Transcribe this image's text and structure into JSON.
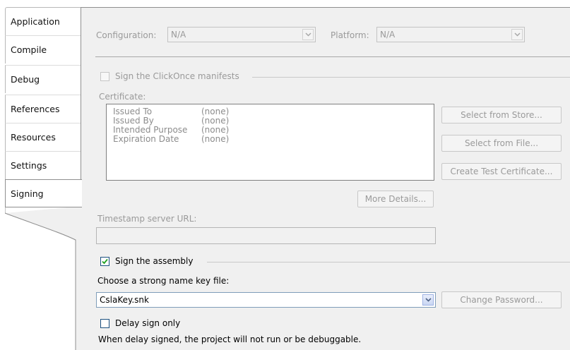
{
  "tabs": [
    {
      "label": "Application"
    },
    {
      "label": "Compile"
    },
    {
      "label": "Debug"
    },
    {
      "label": "References"
    },
    {
      "label": "Resources"
    },
    {
      "label": "Settings"
    },
    {
      "label": "Signing",
      "active": true
    }
  ],
  "config": {
    "configuration_label": "Configuration:",
    "configuration_value": "N/A",
    "platform_label": "Platform:",
    "platform_value": "N/A"
  },
  "clickonce": {
    "sign_manifests_label": "Sign the ClickOnce manifests",
    "sign_manifests_checked": false,
    "certificate_label": "Certificate:",
    "details": [
      {
        "key": "Issued To",
        "value": "(none)"
      },
      {
        "key": "Issued By",
        "value": "(none)"
      },
      {
        "key": "Intended Purpose",
        "value": "(none)"
      },
      {
        "key": "Expiration Date",
        "value": "(none)"
      }
    ],
    "select_from_store": "Select from Store...",
    "select_from_file": "Select from File...",
    "create_test_certificate": "Create Test Certificate...",
    "more_details": "More Details...",
    "timestamp_label": "Timestamp server URL:",
    "timestamp_value": ""
  },
  "assembly": {
    "sign_assembly_label": "Sign the assembly",
    "sign_assembly_checked": true,
    "key_file_label": "Choose a strong name key file:",
    "key_file_value": "CslaKey.snk",
    "change_password": "Change Password...",
    "delay_sign_label": "Delay sign only",
    "delay_sign_checked": false,
    "delay_note": "When delay signed, the project will not run or be debuggable."
  },
  "colors": {
    "panel_bg": "#f0f0f0",
    "disabled_text": "#9a9a9a",
    "check_mark": "#21a121"
  }
}
